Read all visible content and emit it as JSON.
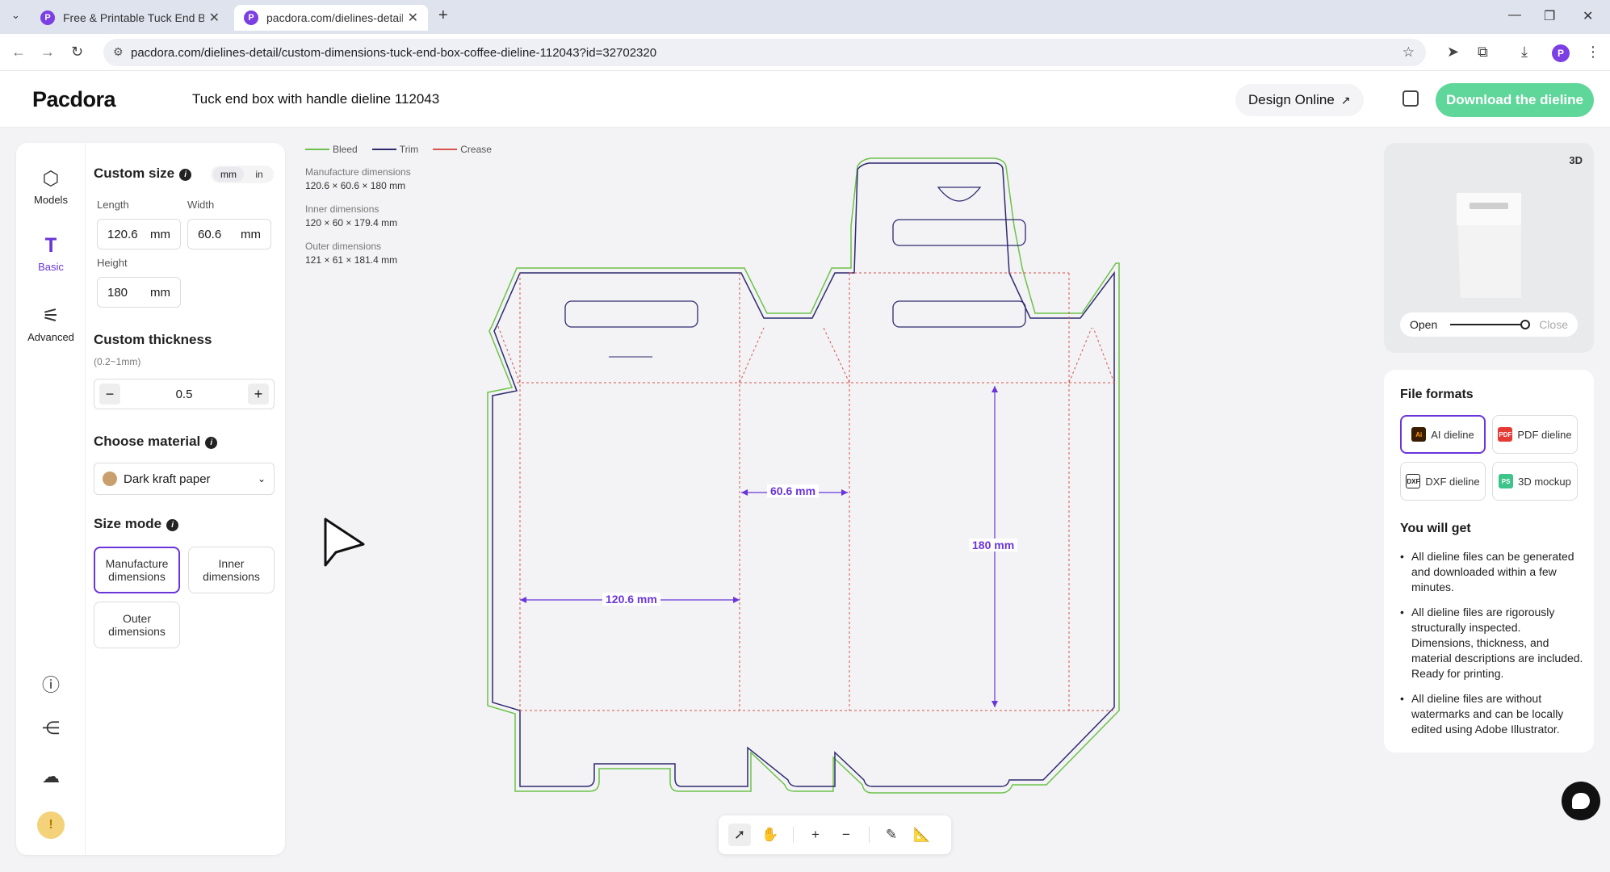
{
  "browser": {
    "tabs": [
      {
        "title": "Free & Printable Tuck End Bo",
        "active": false
      },
      {
        "title": "pacdora.com/dielines-detail/",
        "active": true
      }
    ],
    "url": "pacdora.com/dielines-detail/custom-dimensions-tuck-end-box-coffee-dieline-112043?id=32702320"
  },
  "header": {
    "logo": "Pacdora",
    "title": "Tuck end box with handle dieline 112043",
    "design_online": "Design Online",
    "download": "Download the dieline"
  },
  "rail": {
    "items": [
      {
        "label": "Models",
        "icon": "cube-icon"
      },
      {
        "label": "Basic",
        "icon": "ruler-icon"
      },
      {
        "label": "Advanced",
        "icon": "sliders-icon"
      }
    ]
  },
  "custom_size": {
    "title": "Custom size",
    "units": [
      "mm",
      "in"
    ],
    "length_label": "Length",
    "length": "120.6",
    "width_label": "Width",
    "width": "60.6",
    "height_label": "Height",
    "height": "180",
    "unit": "mm"
  },
  "thickness": {
    "title": "Custom thickness",
    "hint": "(0.2~1mm)",
    "value": "0.5",
    "minus": "−",
    "plus": "+"
  },
  "material": {
    "title": "Choose material",
    "selected": "Dark kraft paper",
    "swatch_color": "#c9a06d"
  },
  "size_mode": {
    "title": "Size mode",
    "options": [
      "Manufacture dimensions",
      "Inner dimensions",
      "Outer dimensions"
    ],
    "selected": "Manufacture dimensions"
  },
  "legend": [
    {
      "label": "Bleed",
      "color": "#6cc24a"
    },
    {
      "label": "Trim",
      "color": "#2e2b6f"
    },
    {
      "label": "Crease",
      "color": "#d9534f"
    }
  ],
  "dimensions": {
    "manufacture_label": "Manufacture dimensions",
    "manufacture": "120.6 × 60.6 × 180 mm",
    "inner_label": "Inner dimensions",
    "inner": "120 × 60 × 179.4 mm",
    "outer_label": "Outer dimensions",
    "outer": "121 × 61 × 181.4 mm"
  },
  "dieline_labels": {
    "width": "60.6 mm",
    "height": "180 mm",
    "length": "120.6 mm"
  },
  "preview": {
    "badge": "3D",
    "open": "Open",
    "close": "Close",
    "open_level": 0.95
  },
  "file_formats": {
    "title": "File formats",
    "options": [
      "AI dieline",
      "PDF dieline",
      "DXF dieline",
      "3D mockup"
    ],
    "selected": "AI dieline"
  },
  "you_will_get": {
    "title": "You will get",
    "items": [
      "All dieline files can be generated and downloaded within a few minutes.",
      "All dieline files are rigorously structurally inspected. Dimensions, thickness, and material descriptions are included. Ready for printing.",
      "All dieline files are without watermarks and can be locally edited using Adobe Illustrator."
    ]
  },
  "colors": {
    "accent": "#6a35d9",
    "download": "#5fd69a"
  }
}
